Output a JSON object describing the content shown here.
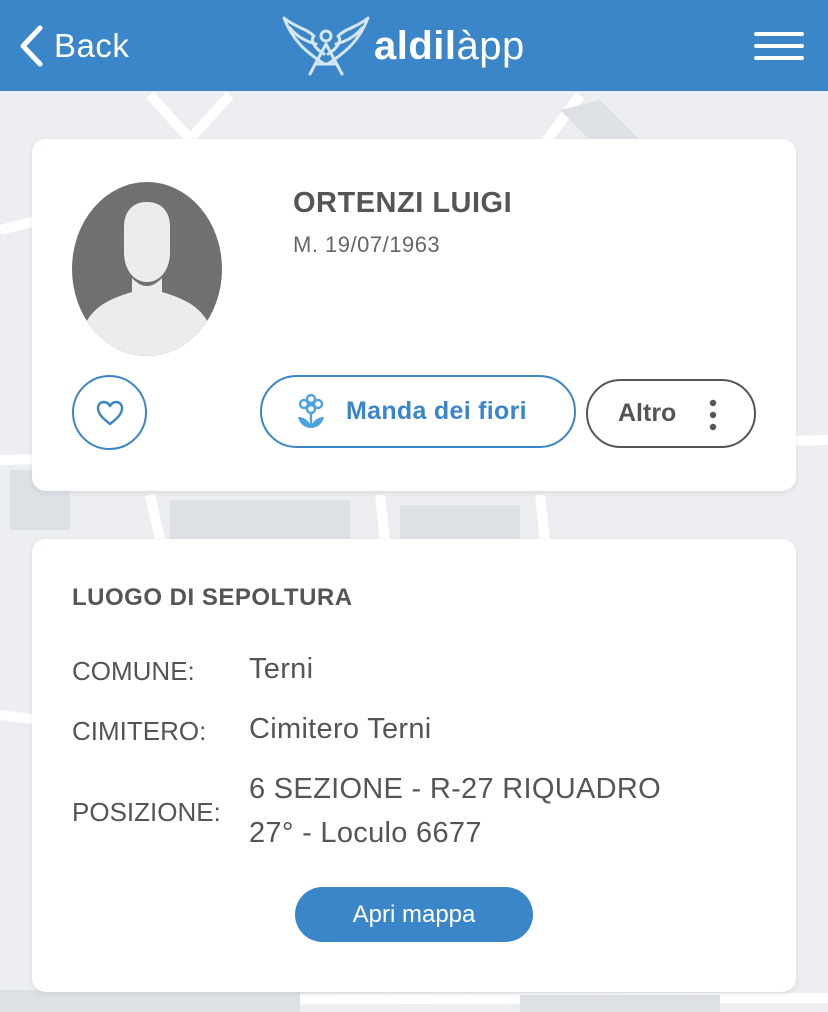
{
  "header": {
    "back_label": "Back",
    "brand_bold": "aldil",
    "brand_light": "àpp",
    "menu_icon": "hamburger-menu-icon"
  },
  "profile": {
    "name": "ORTENZI LUIGI",
    "birth_date": "M. 19/07/1963",
    "avatar_icon": "person-silhouette-icon",
    "favorite_icon": "heart-icon",
    "flowers_label": "Manda dei fiori",
    "flowers_icon": "flower-icon",
    "more_label": "Altro",
    "more_icon": "vertical-dots-icon"
  },
  "burial": {
    "title": "LUOGO DI SEPOLTURA",
    "comune_label": "COMUNE:",
    "comune_value": "Terni",
    "cimitero_label": "CIMITERO:",
    "cimitero_value": "Cimitero Terni",
    "posizione_label": "POSIZIONE:",
    "posizione_line1": "6 SEZIONE - R-27 RIQUADRO",
    "posizione_line2": "27° - Loculo 6677",
    "map_button_label": "Apri mappa"
  },
  "colors": {
    "accent": "#3b86c8",
    "text": "#555555",
    "background": "#eceef1"
  }
}
